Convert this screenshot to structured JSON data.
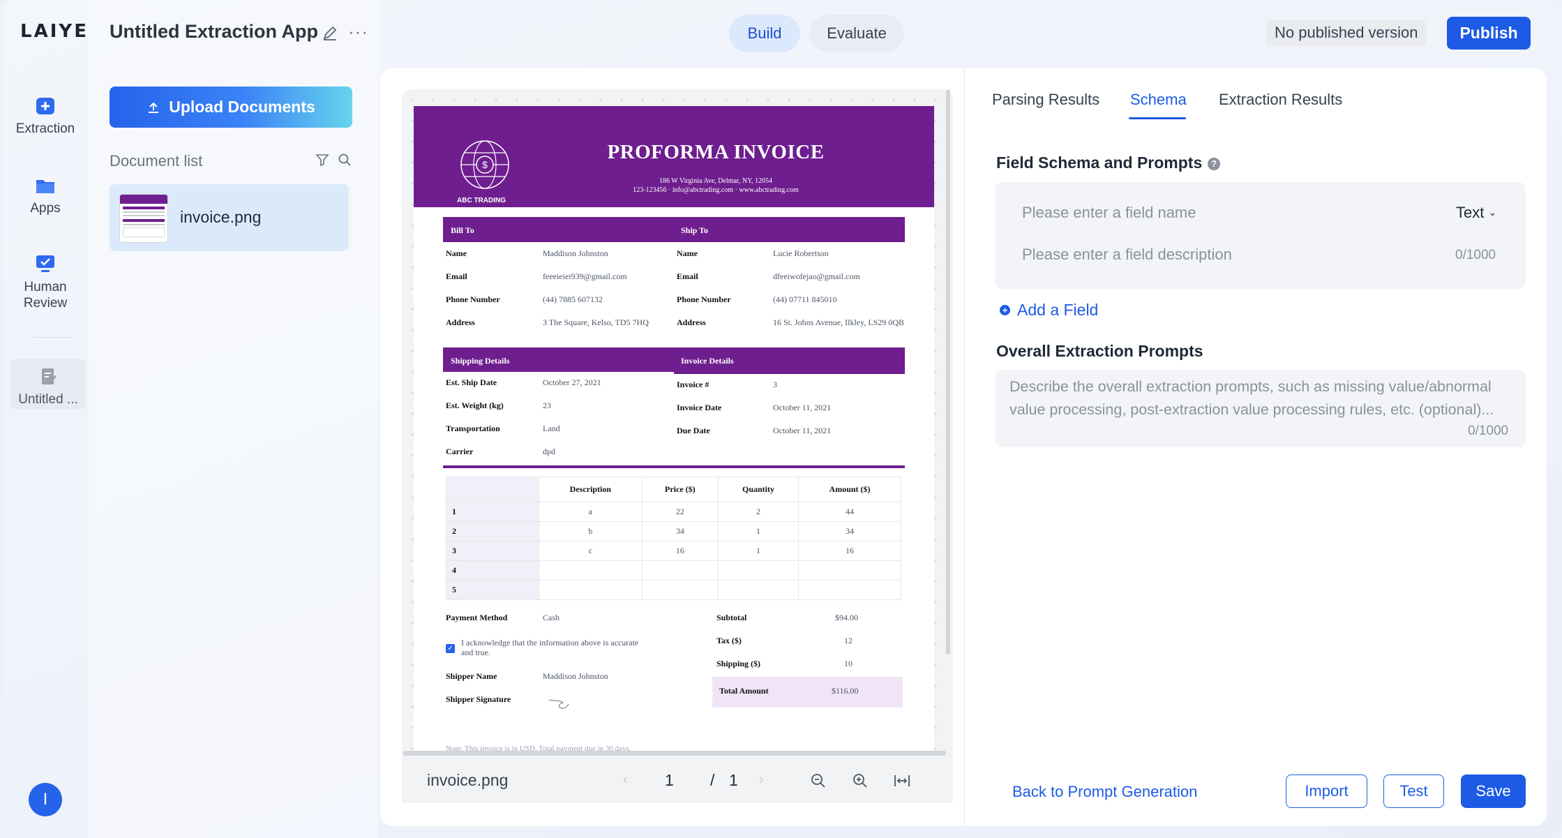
{
  "rail": {
    "logo": "LAIYE",
    "items": [
      {
        "label": "Extraction",
        "icon": "plus-square-icon"
      },
      {
        "label": "Apps",
        "icon": "folder-icon"
      },
      {
        "label": "Human Review",
        "icon": "monitor-check-icon"
      },
      {
        "label": "Untitled ...",
        "icon": "document-edit-icon"
      }
    ],
    "avatar_initial": "I"
  },
  "header": {
    "title": "Untitled Extraction App",
    "build": "Build",
    "evaluate": "Evaluate",
    "status": "No published version",
    "publish": "Publish"
  },
  "documents": {
    "upload_label": "Upload Documents",
    "list_label": "Document list",
    "files": [
      {
        "name": "invoice.png"
      }
    ]
  },
  "invoice": {
    "title": "PROFORMA INVOICE",
    "address_line1": "186 W Virginia Ave, Delmar, NY, 12054",
    "address_line2": "123-123456 · info@abctrading.com · www.abctrading.com",
    "company": "ABC TRADING",
    "bill_to": "Bill To",
    "ship_to": "Ship To",
    "bill": {
      "name_l": "Name",
      "name": "Maddison Johnston",
      "email_l": "Email",
      "email": "feeeieiei939@gmail.com",
      "phone_l": "Phone Number",
      "phone": "(44) 7885 607132",
      "addr_l": "Address",
      "addr": "3 The Square, Kelso, TD5 7HQ"
    },
    "ship": {
      "name_l": "Name",
      "name": "Lucie Robertson",
      "email_l": "Email",
      "email": "dfeeiwofejao@gmail.com",
      "phone_l": "Phone Number",
      "phone": "(44) 07711 845010",
      "addr_l": "Address",
      "addr": "16 St. Johns Avenue, Ilkley, LS29 0QB"
    },
    "shipping_details": "Shipping Details",
    "invoice_details": "Invoice Details",
    "shipping": {
      "date_l": "Est. Ship Date",
      "date": "October 27, 2021",
      "weight_l": "Est. Weight (kg)",
      "weight": "23",
      "transport_l": "Transportation",
      "transport": "Land",
      "carrier_l": "Carrier",
      "carrier": "dpd"
    },
    "details": {
      "num_l": "Invoice #",
      "num": "3",
      "date_l": "Invoice Date",
      "date": "October 11, 2021",
      "due_l": "Due Date",
      "due": "October 11, 2021"
    },
    "table_headers": [
      "",
      "Description",
      "Price ($)",
      "Quantity",
      "Amount ($)"
    ],
    "rows": [
      [
        "1",
        "a",
        "22",
        "2",
        "44"
      ],
      [
        "2",
        "b",
        "34",
        "1",
        "34"
      ],
      [
        "3",
        "c",
        "16",
        "1",
        "16"
      ],
      [
        "4",
        "",
        "",
        "",
        ""
      ],
      [
        "5",
        "",
        "",
        "",
        ""
      ]
    ],
    "payment_l": "Payment Method",
    "payment": "Cash",
    "ack": "I acknowledge that the information above is accurate and true.",
    "shipper_l": "Shipper Name",
    "shipper": "Maddison Johnston",
    "sig_l": "Shipper Signature",
    "subtotal_l": "Subtotal",
    "subtotal": "$94.00",
    "tax_l": "Tax ($)",
    "tax": "12",
    "shipfee_l": "Shipping ($)",
    "shipfee": "10",
    "total_l": "Total Amount",
    "total": "$116.00",
    "note": "Note: This invoice is in USD. Total payment due in 30 days."
  },
  "pager": {
    "file": "invoice.png",
    "page": "1",
    "sep": "/",
    "total": "1"
  },
  "right": {
    "tabs": [
      "Parsing Results",
      "Schema",
      "Extraction Results"
    ],
    "schema_title": "Field Schema and Prompts",
    "field_name_placeholder": "Please enter a field name",
    "field_type": "Text",
    "field_desc_placeholder": "Please enter a field description",
    "desc_count": "0/1000",
    "add_field": "Add a Field",
    "overall_title": "Overall Extraction Prompts",
    "overall_placeholder": "Describe the overall extraction prompts, such as missing value/abnormal value processing, post-extraction value processing rules, etc. (optional)...",
    "overall_count": "0/1000",
    "back": "Back to Prompt Generation",
    "import": "Import",
    "test": "Test",
    "save": "Save"
  },
  "colors": {
    "accent": "#1d5be6",
    "invoice_purple": "#6e1e8e"
  }
}
